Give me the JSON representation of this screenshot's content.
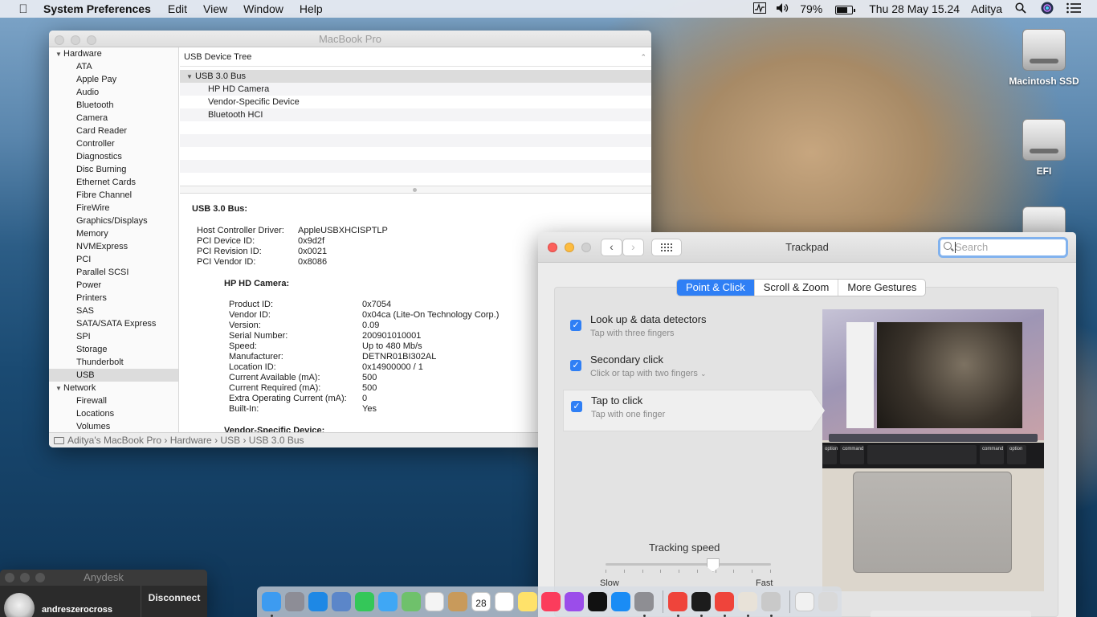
{
  "menubar": {
    "app_name": "System Preferences",
    "items": [
      "Edit",
      "View",
      "Window",
      "Help"
    ],
    "battery": "79%",
    "clock": "Thu 28 May  15.24",
    "user": "Aditya"
  },
  "desktop": {
    "disks": [
      "Macintosh SSD",
      "EFI"
    ]
  },
  "sysinfo": {
    "title": "MacBook Pro",
    "sidebar": {
      "hardware_label": "Hardware",
      "hardware_items": [
        "ATA",
        "Apple Pay",
        "Audio",
        "Bluetooth",
        "Camera",
        "Card Reader",
        "Controller",
        "Diagnostics",
        "Disc Burning",
        "Ethernet Cards",
        "Fibre Channel",
        "FireWire",
        "Graphics/Displays",
        "Memory",
        "NVMExpress",
        "PCI",
        "Parallel SCSI",
        "Power",
        "Printers",
        "SAS",
        "SATA/SATA Express",
        "SPI",
        "Storage",
        "Thunderbolt",
        "USB"
      ],
      "network_label": "Network",
      "network_items": [
        "Firewall",
        "Locations",
        "Volumes"
      ]
    },
    "tree": {
      "header": "USB Device Tree",
      "bus": "USB 3.0 Bus",
      "devices": [
        "HP HD Camera",
        "Vendor-Specific Device",
        "Bluetooth HCI"
      ]
    },
    "details": {
      "heading": "USB 3.0 Bus:",
      "bus_props": [
        {
          "k": "Host Controller Driver:",
          "v": "AppleUSBXHCISPTLP"
        },
        {
          "k": "PCI Device ID:",
          "v": "0x9d2f"
        },
        {
          "k": "PCI Revision ID:",
          "v": "0x0021"
        },
        {
          "k": "PCI Vendor ID:",
          "v": "0x8086"
        }
      ],
      "camera_heading": "HP HD Camera:",
      "camera_props": [
        {
          "k": "Product ID:",
          "v": "0x7054"
        },
        {
          "k": "Vendor ID:",
          "v": "0x04ca  (Lite-On Technology Corp.)"
        },
        {
          "k": "Version:",
          "v": "0.09"
        },
        {
          "k": "Serial Number:",
          "v": "200901010001"
        },
        {
          "k": "Speed:",
          "v": "Up to 480 Mb/s"
        },
        {
          "k": "Manufacturer:",
          "v": "DETNR01BI302AL"
        },
        {
          "k": "Location ID:",
          "v": "0x14900000 / 1"
        },
        {
          "k": "Current Available (mA):",
          "v": "500"
        },
        {
          "k": "Current Required (mA):",
          "v": "500"
        },
        {
          "k": "Extra Operating Current (mA):",
          "v": "0"
        },
        {
          "k": "Built-In:",
          "v": "Yes"
        }
      ],
      "vendor_heading": "Vendor-Specific Device:"
    },
    "statusbar": [
      "Aditya's MacBook Pro",
      "Hardware",
      "USB",
      "USB 3.0 Bus"
    ]
  },
  "trackpad": {
    "title": "Trackpad",
    "search_placeholder": "Search",
    "tabs": [
      "Point & Click",
      "Scroll & Zoom",
      "More Gestures"
    ],
    "options": [
      {
        "title": "Look up & data detectors",
        "sub": "Tap with three fingers",
        "checked": true
      },
      {
        "title": "Secondary click",
        "sub": "Click or tap with two fingers",
        "checked": true
      },
      {
        "title": "Tap to click",
        "sub": "Tap with one finger",
        "checked": true
      }
    ],
    "tracking_label": "Tracking speed",
    "slow_label": "Slow",
    "fast_label": "Fast",
    "tracking_value": 0.65,
    "keyboard_keys": [
      "option",
      "command",
      "command",
      "option"
    ]
  },
  "anydesk": {
    "title": "Anydesk",
    "user": "andreszerocross",
    "disconnect": "Disconnect"
  },
  "dock": {
    "apps": [
      "finder",
      "launchpad",
      "safari",
      "preview",
      "facetime",
      "messages",
      "maps",
      "photos",
      "contacts",
      "calendar",
      "reminders",
      "notes",
      "music",
      "podcasts",
      "tv",
      "app-store",
      "system-preferences",
      "anydesk",
      "terminal",
      "anydesk-2",
      "xcode-tools",
      "automator",
      "downloads",
      "trash"
    ],
    "calendar_day": "28"
  },
  "colors": {
    "accent": "#2f7ff5",
    "close": "#fc605c",
    "minimize": "#fdbc40",
    "zoom_inactive": "#d0d0d0"
  }
}
